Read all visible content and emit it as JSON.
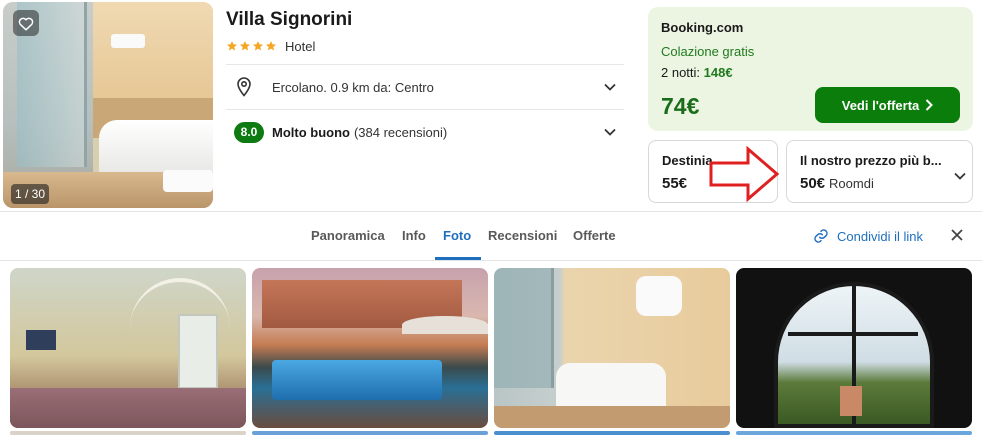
{
  "hotel": {
    "name": "Villa Signorini",
    "stars": 4,
    "type": "Hotel",
    "photo_counter": "1 / 30",
    "location": "Ercolano. 0.9 km da: Centro",
    "rating_score": "8.0",
    "rating_word": "Molto buono",
    "rating_count": "(384 recensioni)"
  },
  "offer": {
    "provider": "Booking.com",
    "breakfast": "Colazione gratis",
    "nights_label": "2 notti:",
    "nights_price": "148€",
    "price": "74€",
    "cta_label": "Vedi l'offerta"
  },
  "alternatives": [
    {
      "label": "Destinia",
      "price": "55€",
      "source": ""
    },
    {
      "label": "Il nostro prezzo più b...",
      "price": "50€",
      "source": "Roomdi"
    }
  ],
  "tabs": [
    "Panoramica",
    "Info",
    "Foto",
    "Recensioni",
    "Offerte"
  ],
  "active_tab": "Foto",
  "share_label": "Condividi il link",
  "colors": {
    "accent_blue": "#1f6fbf",
    "deal_green": "#0b7d0b",
    "offer_bg": "#ebf5e2",
    "star": "#f5a623",
    "annotation_arrow": "#e02020"
  }
}
